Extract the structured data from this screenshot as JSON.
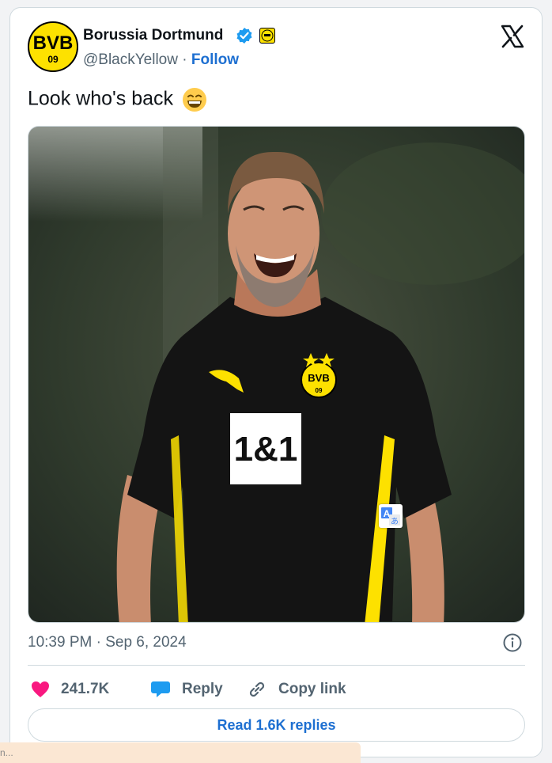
{
  "account": {
    "name": "Borussia Dortmund",
    "handle": "@BlackYellow",
    "separator": "·",
    "follow_label": "Follow",
    "avatar_text_top": "BVB",
    "avatar_text_bottom": "09"
  },
  "tweet": {
    "text": "Look who's back",
    "emoji": "grinning-face-with-smiling-eyes",
    "timestamp": "10:39 PM · Sep 6, 2024"
  },
  "media": {
    "shirt_sponsor": "1&1",
    "crest_top": "BVB",
    "crest_bottom": "09"
  },
  "actions": {
    "likes_count": "241.7K",
    "reply_label": "Reply",
    "copy_link_label": "Copy link",
    "read_replies_label": "Read 1.6K replies"
  },
  "colors": {
    "accent_blue": "#1d6fd1",
    "like_pink": "#f91880",
    "text_primary": "#0f1419",
    "text_secondary": "#536471",
    "bvb_yellow": "#fde100"
  },
  "footer": {
    "fragment": "n..."
  }
}
